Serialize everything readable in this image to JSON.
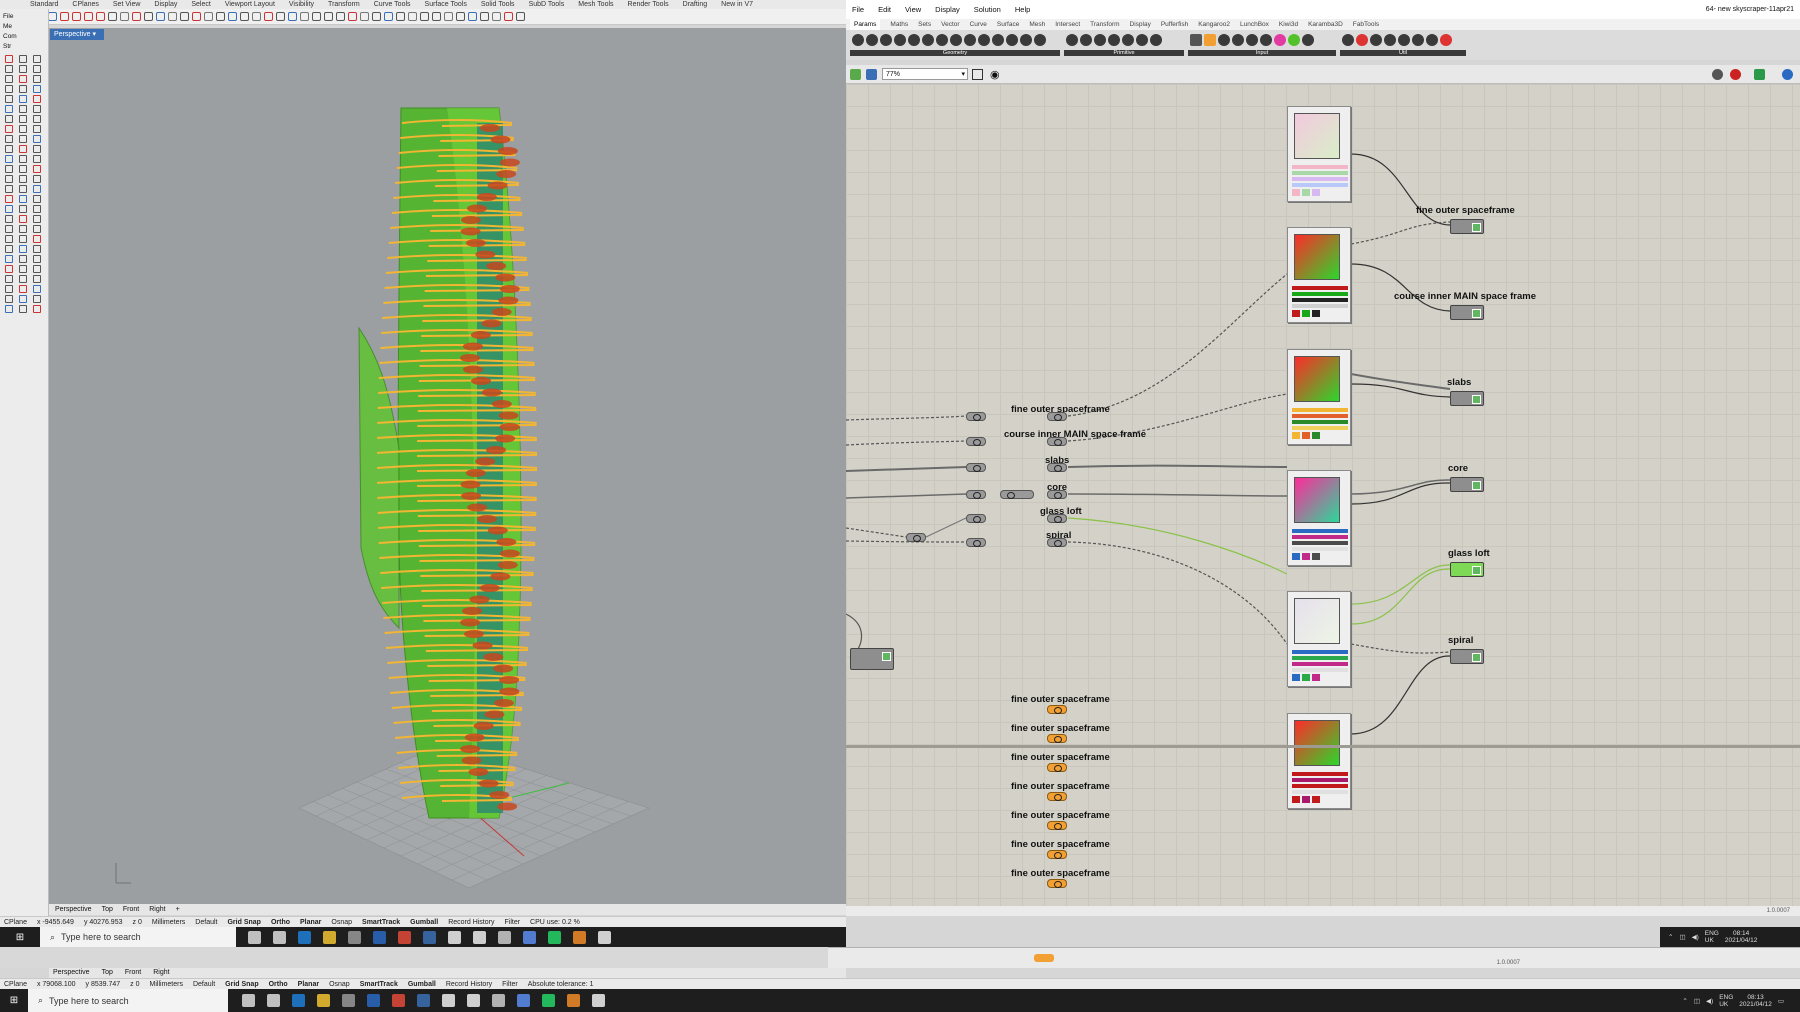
{
  "rhino": {
    "tabs": [
      "Standard",
      "CPlanes",
      "Set View",
      "Display",
      "Select",
      "Viewport Layout",
      "Visibility",
      "Transform",
      "Curve Tools",
      "Surface Tools",
      "Solid Tools",
      "SubD Tools",
      "Mesh Tools",
      "Render Tools",
      "Drafting",
      "New in V7"
    ],
    "side_labels": [
      "File",
      "Me",
      "Com",
      "Str"
    ],
    "viewport_label": "Perspective",
    "viewport_tabs": [
      "Perspective",
      "Top",
      "Front",
      "Right"
    ],
    "status_top": {
      "cplane": "CPlane",
      "x": "x -9455.649",
      "y": "y 40276.953",
      "z": "z 0",
      "units": "Millimeters",
      "layer": "Default",
      "toggles": [
        "Grid Snap",
        "Ortho",
        "Planar",
        "Osnap",
        "SmartTrack",
        "Gumball",
        "Record History",
        "Filter"
      ],
      "cpu": "CPU use: 0.2 %"
    },
    "status_bottom": {
      "cplane": "CPlane",
      "x": "x 79068.100",
      "y": "y 8539.747",
      "z": "z 0",
      "units": "Millimeters",
      "layer": "Default",
      "toggles": [
        "Grid Snap",
        "Ortho",
        "Planar",
        "Osnap",
        "SmartTrack",
        "Gumball",
        "Record History",
        "Filter"
      ],
      "tolerance": "Absolute tolerance: 1"
    },
    "tabs_bottom": [
      "Perspective",
      "Top",
      "Front",
      "Right"
    ]
  },
  "grasshopper": {
    "title": "64- new skyscraper-11apr21",
    "menu": [
      "File",
      "Edit",
      "View",
      "Display",
      "Solution",
      "Help"
    ],
    "tabs": [
      "Params",
      "Maths",
      "Sets",
      "Vector",
      "Curve",
      "Surface",
      "Mesh",
      "Intersect",
      "Transform",
      "Display",
      "Pufferfish",
      "Kangaroo2",
      "LunchBox",
      "Kiwi3d",
      "Karamba3D",
      "FabTools"
    ],
    "groups": [
      "Geometry",
      "Primitive",
      "Input",
      "Util"
    ],
    "zoom": "77%",
    "left_labels": [
      "fine outer spaceframe",
      "course inner MAIN space frame",
      "slabs",
      "core",
      "glass loft",
      "spiral"
    ],
    "right_labels": [
      "fine outer spaceframe",
      "course inner MAIN space frame",
      "slabs",
      "core",
      "glass loft",
      "spiral"
    ],
    "bottom_labels": [
      "fine outer spaceframe",
      "fine outer spaceframe",
      "fine outer spaceframe",
      "fine outer spaceframe",
      "fine outer spaceframe",
      "fine outer spaceframe",
      "fine outer spaceframe"
    ],
    "version": "1.0.0007",
    "version2": "1.0.0007"
  },
  "taskbar_top": {
    "search": "Type here to search",
    "lang": "ENG",
    "region": "UK",
    "time": "08:14",
    "date": "2021/04/12"
  },
  "taskbar_bottom": {
    "search": "Type here to search",
    "lang": "ENG",
    "region": "UK",
    "time": "08:13",
    "date": "2021/04/12"
  },
  "colors": {
    "tower_green": "#5cc12a",
    "slab_orange": "#f2b632",
    "spiral_red": "#c8471f",
    "core_teal": "#2e8a6e",
    "canvas": "#d4d2c8",
    "viewport": "#9c9fa2"
  }
}
